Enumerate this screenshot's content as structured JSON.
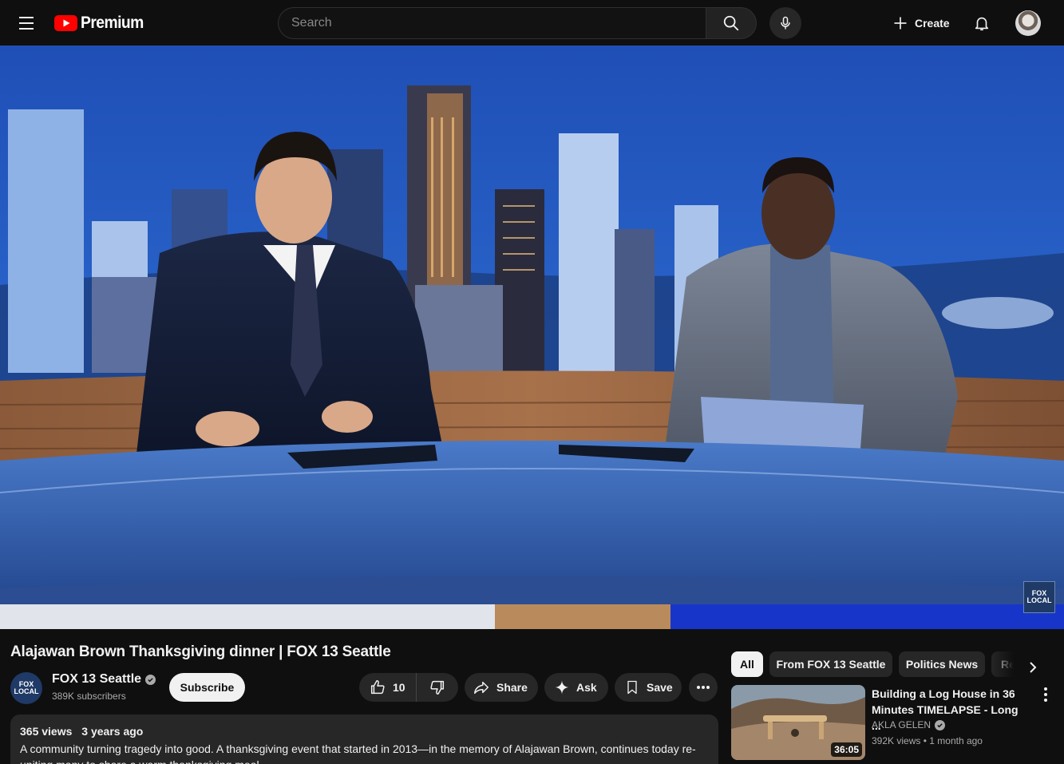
{
  "header": {
    "logo_text": "Premium",
    "search_placeholder": "Search",
    "create_label": "Create"
  },
  "player": {
    "watermark_line1": "FOX",
    "watermark_line2": "LOCAL"
  },
  "video": {
    "title": "Alajawan Brown Thanksgiving dinner | FOX 13 Seattle",
    "channel_name": "FOX 13 Seattle",
    "subscriber_count": "389K subscribers",
    "subscribe_label": "Subscribe",
    "like_count": "10",
    "share_label": "Share",
    "ask_label": "Ask",
    "save_label": "Save",
    "views": "365 views",
    "published": "3 years ago",
    "description": "A community turning tragedy into good. A thanksgiving event that started in 2013—in the memory of Alajawan Brown, continues today re-uniting many to share a warm thanksgiving meal."
  },
  "sidebar": {
    "chips": [
      {
        "label": "All",
        "active": true
      },
      {
        "label": "From FOX 13 Seattle",
        "active": false
      },
      {
        "label": "Politics News",
        "active": false
      },
      {
        "label": "Re",
        "active": false
      }
    ],
    "recommendations": [
      {
        "title": "Building a Log House in 36 Minutes TIMELAPSE - Long ...",
        "channel": "AKLA GELEN",
        "views": "392K views",
        "age": "1 month ago",
        "duration": "36:05"
      }
    ]
  },
  "colors": {
    "background": "#0f0f0f",
    "surface": "#272727",
    "brand_red": "#ff0000",
    "studio_blue": "#2a62c9"
  }
}
